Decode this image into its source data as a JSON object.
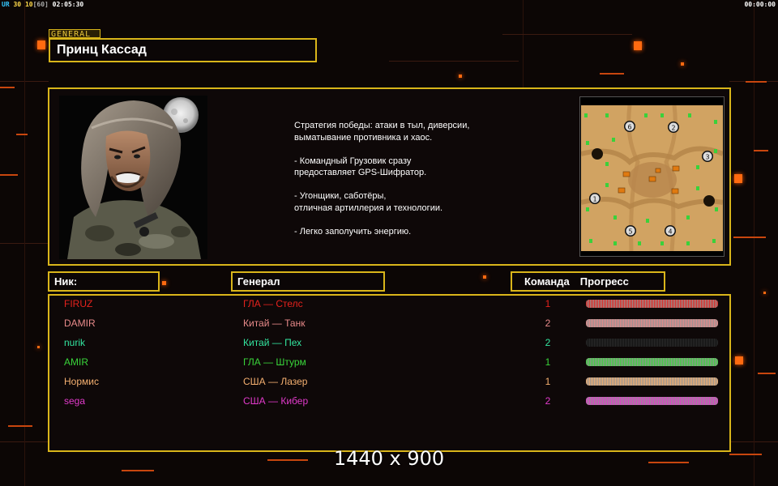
{
  "hud": {
    "ur_label": "UR",
    "ur_value": "30",
    "fps": "10",
    "fps_max": "[60]",
    "clock": "02:05:30",
    "timer": "00:00:00"
  },
  "general": {
    "tag": "GENERAL",
    "name": "Принц Кассад",
    "description": "Стратегия победы: атаки в тыл, диверсии,\n выматывание противника и хаос.\n\n- Командный Грузовик сразу\nпредоставляет GPS-Шифратор.\n\n- Угонщики, саботёры,\nотличная артиллерия и технологии.\n\n- Легко заполучить энергию."
  },
  "minimap": {
    "start_positions": [
      "1",
      "2",
      "3",
      "4",
      "5",
      "6"
    ]
  },
  "table": {
    "header_nick": "Ник:",
    "header_general": "Генерал",
    "header_team": "Команда",
    "header_progress": "Прогресс"
  },
  "players": [
    {
      "nick": "FIRUZ",
      "general": "ГЛА — Стелс",
      "team": "1",
      "color": "#e5221d",
      "progress": 1.0
    },
    {
      "nick": "DAMIR",
      "general": "Китай — Танк",
      "team": "2",
      "color": "#e88a8a",
      "progress": 1.0
    },
    {
      "nick": "nurik",
      "general": "Китай — Пех",
      "team": "2",
      "color": "#33e6a0",
      "progress": 0.0
    },
    {
      "nick": "AMIR",
      "general": "ГЛА — Штурм",
      "team": "1",
      "color": "#39d43a",
      "progress": 1.0
    },
    {
      "nick": "Нормис",
      "general": "США — Лазер",
      "team": "1",
      "color": "#f5b070",
      "progress": 1.0
    },
    {
      "nick": "sega",
      "general": "США — Кибер",
      "team": "2",
      "color": "#e23acb",
      "progress": 1.0
    }
  ],
  "resolution": "1440 x 900"
}
